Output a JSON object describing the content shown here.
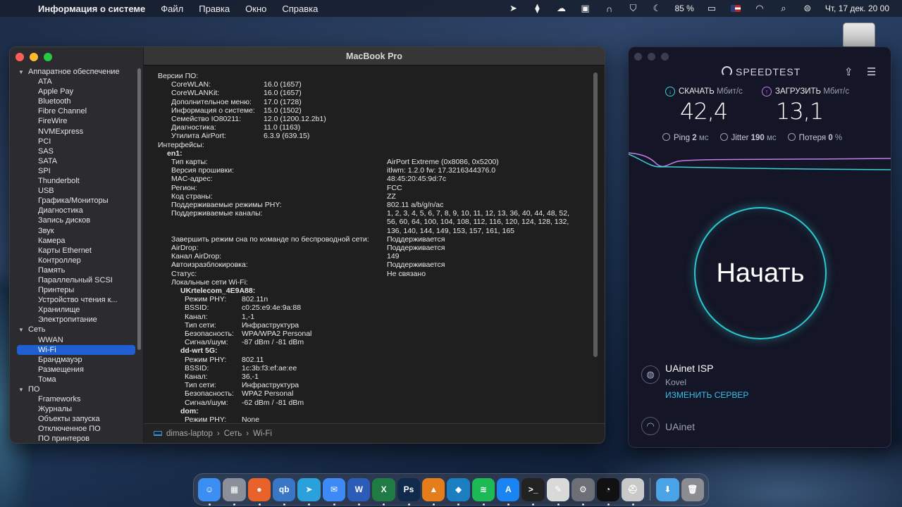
{
  "menubar": {
    "app_name": "Информация о системе",
    "menus": [
      "Файл",
      "Правка",
      "Окно",
      "Справка"
    ],
    "battery": "85 %",
    "datetime": "Чт, 17 дек.  20 00"
  },
  "window": {
    "title": "MacBook Pro",
    "breadcrumb": [
      "dimas-laptop",
      "Сеть",
      "Wi-Fi"
    ]
  },
  "sidebar": {
    "hardware": {
      "label": "Аппаратное обеспечение",
      "items": [
        "ATA",
        "Apple Pay",
        "Bluetooth",
        "Fibre Channel",
        "FireWire",
        "NVMExpress",
        "PCI",
        "SAS",
        "SATA",
        "SPI",
        "Thunderbolt",
        "USB",
        "Графика/Мониторы",
        "Диагностика",
        "Запись дисков",
        "Звук",
        "Камера",
        "Карты Ethernet",
        "Контроллер",
        "Память",
        "Параллельный SCSI",
        "Принтеры",
        "Устройство чтения к...",
        "Хранилище",
        "Электропитание"
      ]
    },
    "network": {
      "label": "Сеть",
      "items": [
        "WWAN",
        "Wi-Fi",
        "Брандмауэр",
        "Размещения",
        "Тома"
      ]
    },
    "software": {
      "label": "ПО",
      "items": [
        "Frameworks",
        "Журналы",
        "Объекты запуска",
        "Отключенное ПО",
        "ПО принтеров"
      ]
    }
  },
  "details": {
    "versions_header": "Версии ПО:",
    "versions": [
      [
        "CoreWLAN:",
        "16.0 (1657)"
      ],
      [
        "CoreWLANKit:",
        "16.0 (1657)"
      ],
      [
        "Дополнительное меню:",
        "17.0 (1728)"
      ],
      [
        "Информация о системе:",
        "15.0 (1502)"
      ],
      [
        "Семейство IO80211:",
        "12.0 (1200.12.2b1)"
      ],
      [
        "Диагностика:",
        "11.0 (1163)"
      ],
      [
        "Утилита AirPort:",
        "6.3.9 (639.15)"
      ]
    ],
    "interfaces_header": "Интерфейсы:",
    "iface_name": "en1:",
    "iface_props": [
      [
        "Тип карты:",
        "AirPort Extreme  (0x8086, 0x5200)"
      ],
      [
        "Версия прошивки:",
        "itlwm: 1.2.0 fw: 17.3216344376.0"
      ],
      [
        "MAC-адрес:",
        "48:45:20:45:9d:7c"
      ],
      [
        "Регион:",
        "FCC"
      ],
      [
        "Код страны:",
        "ZZ"
      ],
      [
        "Поддерживаемые режимы PHY:",
        "802.11 a/b/g/n/ac"
      ]
    ],
    "channels_label": "Поддерживаемые каналы:",
    "channels_lines": [
      "1, 2, 3, 4, 5, 6, 7, 8, 9, 10, 11, 12, 13, 36, 40, 44, 48, 52,",
      "56, 60, 64, 100, 104, 108, 112, 116, 120, 124, 128, 132,",
      "136, 140, 144, 149, 153, 157, 161, 165"
    ],
    "iface_props2": [
      [
        "Завершить режим сна по команде по беспроводной сети:",
        "Поддерживается"
      ],
      [
        "AirDrop:",
        "Поддерживается"
      ],
      [
        "Канал AirDrop:",
        "149"
      ],
      [
        "Автоизразблокировка:",
        "Поддерживается"
      ],
      [
        "Статус:",
        "Не связано"
      ]
    ],
    "local_networks_header": "Локальные сети Wi-Fi:",
    "networks": [
      {
        "name": "UKrtelecom_4E9A88:",
        "props": [
          [
            "Режим PHY:",
            "802.11n"
          ],
          [
            "BSSID:",
            "c0:25:e9:4e:9a:88"
          ],
          [
            "Канал:",
            "1,-1"
          ],
          [
            "Тип сети:",
            "Инфраструктура"
          ],
          [
            "Безопасность:",
            "WPA/WPA2 Personal"
          ],
          [
            "Сигнал/шум:",
            "-87 dBm / -81 dBm"
          ]
        ]
      },
      {
        "name": "dd-wrt 5G:",
        "props": [
          [
            "Режим PHY:",
            "802.11"
          ],
          [
            "BSSID:",
            "1c:3b:f3:ef:ae:ee"
          ],
          [
            "Канал:",
            "36,-1"
          ],
          [
            "Тип сети:",
            "Инфраструктура"
          ],
          [
            "Безопасность:",
            "WPA2 Personal"
          ],
          [
            "Сигнал/шум:",
            "-62 dBm / -81 dBm"
          ]
        ]
      },
      {
        "name": "dom:",
        "props": [
          [
            "Режим PHY:",
            "None"
          ]
        ]
      }
    ]
  },
  "speedtest": {
    "logo": "SPEEDTEST",
    "download_label": "СКАЧАТЬ",
    "upload_label": "ЗАГРУЗИТЬ",
    "unit": "Мбит/с",
    "download_value": "42,4",
    "upload_value": "13,1",
    "ping_label": "Ping",
    "ping_value": "2",
    "ping_unit": "мс",
    "jitter_label": "Jitter",
    "jitter_value": "190",
    "jitter_unit": "мс",
    "loss_label": "Потеря",
    "loss_value": "0",
    "loss_unit": "%",
    "go_label": "Начать",
    "isp": "UAinet ISP",
    "location": "Kovel",
    "change_server": "ИЗМЕНИТЬ СЕРВЕР",
    "network": "UAinet",
    "colors": {
      "download": "#39d3d6",
      "upload": "#c17ee9",
      "accent": "#2ec7cf"
    }
  },
  "dock": {
    "apps": [
      {
        "icon": "finder-icon",
        "glyph": "☺",
        "color": "#3b8ff3"
      },
      {
        "icon": "launchpad-icon",
        "glyph": "▦",
        "color": "#8a8f99"
      },
      {
        "icon": "firefox-icon",
        "glyph": "●",
        "color": "#e8622a"
      },
      {
        "icon": "qbittorrent-icon",
        "glyph": "qb",
        "color": "#3a76c6"
      },
      {
        "icon": "telegram-icon",
        "glyph": "➤",
        "color": "#2aa1da"
      },
      {
        "icon": "mail-icon",
        "glyph": "✉",
        "color": "#3d8af7"
      },
      {
        "icon": "word-icon",
        "glyph": "W",
        "color": "#2b5cb8"
      },
      {
        "icon": "excel-icon",
        "glyph": "X",
        "color": "#1f7a44"
      },
      {
        "icon": "photoshop-icon",
        "glyph": "Ps",
        "color": "#0f2a4a"
      },
      {
        "icon": "vlc-icon",
        "glyph": "▲",
        "color": "#e57e1a"
      },
      {
        "icon": "kodi-icon",
        "glyph": "◆",
        "color": "#1b7ec0"
      },
      {
        "icon": "spotify-icon",
        "glyph": "≋",
        "color": "#1db954"
      },
      {
        "icon": "app-store-icon",
        "glyph": "A",
        "color": "#1a84f3"
      },
      {
        "icon": "terminal-icon",
        "glyph": ">_",
        "color": "#222"
      },
      {
        "icon": "preview-icon",
        "glyph": "✎",
        "color": "#d9d9d9"
      },
      {
        "icon": "system-preferences-icon",
        "glyph": "⚙",
        "color": "#6c6f76"
      },
      {
        "icon": "speedtest-icon",
        "glyph": "◔",
        "color": "#111"
      },
      {
        "icon": "disk-utility-icon",
        "glyph": "⛑",
        "color": "#c9c9c9"
      }
    ],
    "trailing": [
      {
        "icon": "downloads-folder-icon",
        "glyph": "⬇",
        "color": "#4aa3e6"
      },
      {
        "icon": "trash-icon",
        "glyph": "🗑",
        "color": "#8b8d92"
      }
    ]
  }
}
